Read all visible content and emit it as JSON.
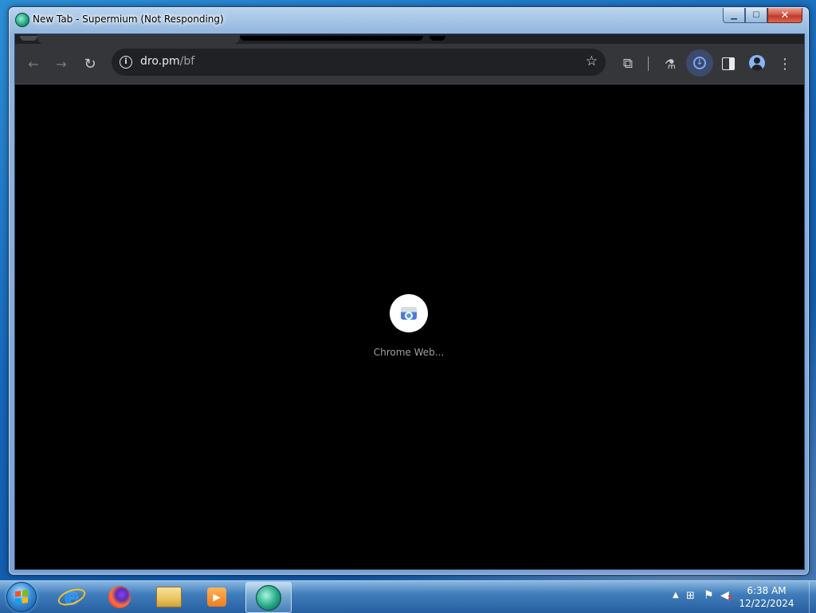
{
  "window": {
    "title": "New Tab - Supermium (Not Responding)",
    "caption": {
      "minimize": "▁",
      "maximize": "☐",
      "close": "✕"
    }
  },
  "toolbar": {
    "back": "←",
    "forward": "→",
    "reload": "↻",
    "url_host": "dro.pm",
    "url_path": "/bf",
    "info": "i",
    "bookmark": "☆",
    "extensions": "⧉",
    "labs": "⚗",
    "download": "↓",
    "menu": "⋮"
  },
  "page": {
    "background": "#000000",
    "shortcut_tile_label": "Chrome Web..."
  },
  "taskbar": {
    "pinned": [
      "internet-explorer",
      "firefox",
      "windows-explorer",
      "media-player",
      "supermium"
    ],
    "active": "supermium",
    "media_glyph": "▶",
    "ie_glyph": "e",
    "tray": {
      "arrow": "▲",
      "network": "⊞",
      "flag": "⚑",
      "volume": "◀",
      "muted": "x"
    },
    "clock_time": "6:38 AM",
    "clock_date": "12/22/2024"
  },
  "colors": {
    "toolbar_bg": "#35363a",
    "omnibox_bg": "#202124",
    "accent_blue": "#8ab4f8"
  }
}
